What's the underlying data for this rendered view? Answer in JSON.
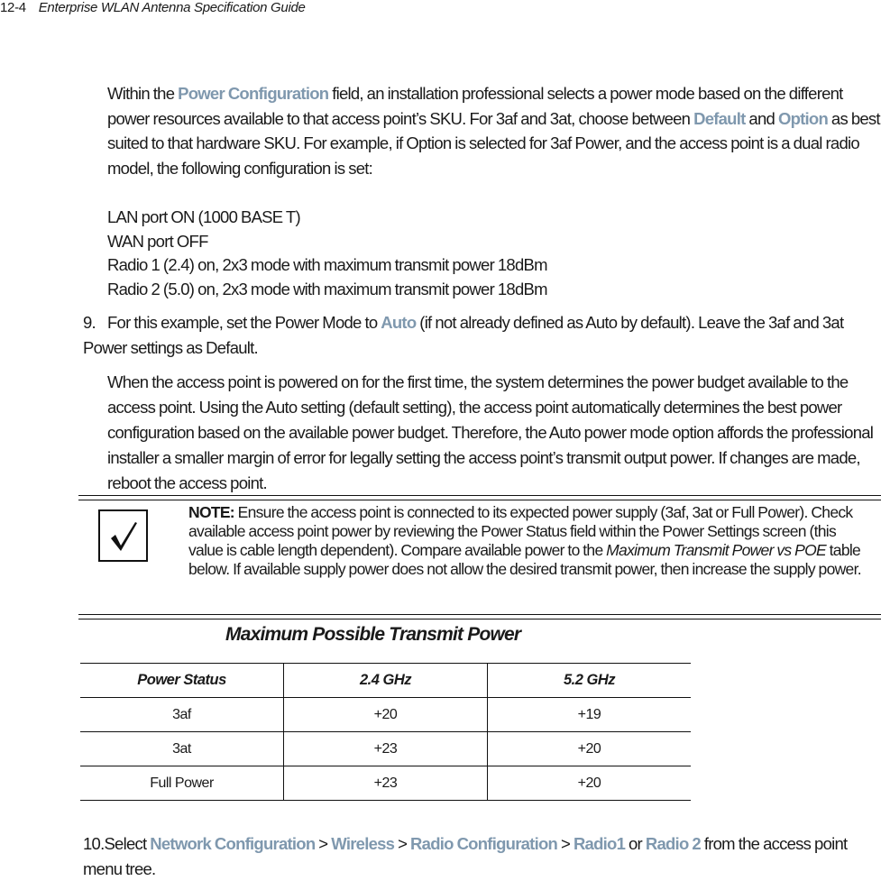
{
  "header": {
    "page_number": "12-4",
    "title": "Enterprise WLAN Antenna Specification Guide"
  },
  "intro": {
    "t1": "Within the ",
    "h1": "Power Configuration",
    "t2": " field, an installation professional selects a power mode based on the different power resources available to that access point’s SKU. For 3af and 3at, choose between ",
    "h2": "Default",
    "t3": " and ",
    "h3": "Option",
    "t4": " as best suited to that hardware SKU. For example, if Option is selected for 3af Power, and the access point is a dual radio model, the following configuration is set:"
  },
  "config_lines": [
    "LAN port ON (1000 BASE T)",
    "WAN port OFF",
    "Radio 1 (2.4) on, 2x3 mode with maximum transmit power 18dBm",
    "Radio 2 (5.0) on, 2x3 mode with maximum transmit power 18dBm"
  ],
  "step9": {
    "number": "9.",
    "t1": "For this example, set the Power Mode to ",
    "h1": "Auto",
    "t2": " (if not already defined as Auto by default). Leave the 3af and 3at Power settings as Default."
  },
  "step9_detail": "When the access point is powered on for the first time, the system determines the power budget available to the access point. Using the Auto setting (default setting), the access point automatically determines the best power configuration based on the available power budget. Therefore, the Auto power mode option affords the professional installer a smaller margin of error for legally setting the access point’s transmit output power. If changes are made, reboot the access point.",
  "note": {
    "icon": "checkmark-icon",
    "label": "NOTE:",
    "t1": " Ensure the access point is connected to its expected power supply (3af, 3at or Full Power). Check available access point power by reviewing the Power Status field within the Power Settings screen (this value is cable length dependent). Compare available power to the ",
    "italic": "Maximum Transmit Power vs POE",
    "t2": " table below. If available supply power does not allow the desired transmit power, then increase the supply power."
  },
  "table": {
    "title": "Maximum Possible Transmit Power",
    "headers": [
      "Power Status",
      "2.4 GHz",
      "5.2 GHz"
    ],
    "rows": [
      [
        "3af",
        "+20",
        "+19"
      ],
      [
        "3at",
        "+23",
        "+20"
      ],
      [
        "Full Power",
        "+23",
        "+20"
      ]
    ]
  },
  "step10": {
    "number": "10.",
    "t1": "Select ",
    "h1": "Network Configuration",
    "sep1": " > ",
    "h2": "Wireless",
    "sep2": " > ",
    "h3": "Radio Configuration",
    "sep3": " > ",
    "h4": "Radio1",
    "t2": " or ",
    "h5": "Radio 2",
    "t3": " from the access point menu tree."
  },
  "colors": {
    "highlight": "#7f98ae",
    "text": "#1a1a1a"
  }
}
